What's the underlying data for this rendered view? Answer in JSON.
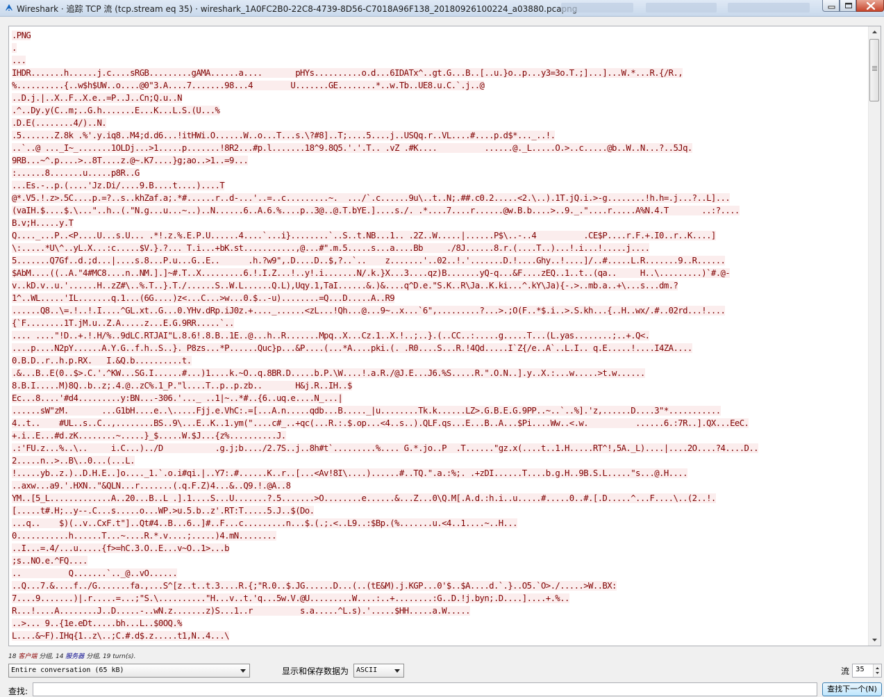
{
  "window": {
    "title": "Wireshark · 追踪 TCP 流 (tcp.stream eq 35) · wireshark_1A0FC2B0-22C8-4739-8D56-C7018A96F138_20180926100224_a03880.pcapng"
  },
  "stream": {
    "lines": [
      ".PNG",
      ".",
      "...",
      "IHDR.......h......j.c....sRGB.........gAMA......a....       pHYs..........o.d...6IDATx^..gt.G...B..[..u.}o..p...y3=3o.T.;]...]...W.*...R.{/R.,",
      "%..........{..w$h$UW..o....@0\"3.A....7.......98...4        U.......GE........*..w.Tb..UE8.u.C.`.j..@",
      "..D.j.|..X..F..X.e..=P..J..Cn;Q.u..N",
      ".^..Dy.y(C..m;..G.h.......E...K...L.S.(U...%",
      ".D.E(........4/)..N.",
      ".5.......Z.8k .%'.y.iq8..M4;d.d6...!itHWi.O......W..o...T...s.\\?#8]..T;....5....j..USQq.r..VL....#....p.d$*..._..!.",
      "..`..@ ..._I~_.......1OLDj...>1.....p.......!8R2...#p.l.......18^9.8Q5.'.'.T.. .vZ .#K....          ......@._L.....O.>..c.....@b..W..N...?..5Jq.",
      "9RB...~^.p....>..8T....z.@~.K7....}g;ao..>1..=9...",
      ":......8.......u.....p8R..G",
      "...Es.-..p.(....'Jz.Di/....9.B....t....)....T",
      "@*.V5.!.z>.5C....p.=?..s..khZaf.a;.*#......r..d-...'..=..c.........~.  .../`.c......9u\\..t..N;.##.c0.2.....<2.\\..).1T.jQ.i.>-g........!h.h=.j...?..L]...",
      "(vaIH.$....$.\\...\"..h..(.\"N.g...u...~..)..N......6..A.6.%....p..3@..@.T.bYE.]....s./. .*....7....r......@w.B.b....>..9._.\"....r.....A%N.4.T       ..:?....",
      "B.v;H.....y.T",
      "Q...._...P..<P....U...s.U... .*!.z.%.E.P.U......4....`...i}........`..S..t.NB...1.. .2Z..W.....|......P$\\..-..4          .CE$P....r.F.+.I0..r..K....]",
      "\\:.....*U\\^..yL.X...:c.....$V.}.?... T.i...+bK.st...........,@...#\".m.5.....s...a....Bb     ./8J......8.r.(....T..)...!.i...!.....j....",
      "5.......Q7Gf..d.;d...|....s.8...P.u...G..E..      .h.?w9\",.D....D..$,?..`..    z.......'..02..!.'.......D.!....Ghy..!....]/..#.....L.R.......9..R......",
      "$AbM....((..A.\"4#MC8....n..NM.].]~#.T..X.........6.!.I.Z...!..y!.i.......N/.k.}X...3....qz)B.......yQ-q...&F....zEQ..1..t..(qa..     H..\\.........)`#.@-",
      "v..kD.v..u.'......H..zZ#\\..%.T..}.T./......S..W.L......Q.L),Uqy.1,TaI......&.)&....q^D.e.\"S.K..R\\Ja..K.ki...^.kY\\Ja){-.>..mb.a..+\\...s...dm.?",
      "1^..WL.....'IL.......q.1...(6G....)z<...C...>w...0.$..-u)........=Q...D.....A..R9",
      "......Q8..\\=.!..!.I....^GL.xt..G...0.YHv.dRp.iJ0z.+...._......<zL...!Qh...@...9~..x...`6\",.........?...>.;O(F..*$.i..>.S.kh...{..H..wx/.#..02rd...!....",
      "{`F........1T.jM.u..Z.A.....z...E.G.9RR.....`..",
      ".... ....\"!D..+.!.H/%..9dLC.RTJAI\"L.8.6!.8.B..1E..@...h..R.......Mpq..X...Cz.1..X.!..;..}.(..CC..:.....g.....T...(L.yas........;..+.Q<.",
      "....p....N2pY......A.Y.G..f.h..S..}. P8zs...*P......Quc}p...&P....(...*A....pki.(. .R0....S...R.!4Qd.....I`Z{/e..A`..L.I.. q.E.....!....I4ZA....",
      "0.B.D..r..h.p.RX.   I.&Q.b..........t.",
      ".&...B..E(0..$>.C.'.^KW...SG.I......#...)1....k.~O..q.8BR.D.....b.P.\\W....!.a.R./@J.E...J6.%S.....R.\".O.N..].y..X.:...w.....>t.w......",
      "8.B.I.....M)8Q..b..z;.4.@..zC%.1_P.\"l....T..p..p.zb..       H&j.R..IH..$",
      "Ec...8....'#d4.........y:BN...-306.'..._ ..1|~..*#..{6..uq.e....N_...|",
      "......sW\"zM.       ...G1bH....e..\\.....Fjj.e.VhC:.=[...A.n.....qdb...B....._|u........Tk.k......LZ>.G.B.E.G.9PP..~..`..%].'z,......D....3\"*...........",
      "4..t..    #UL..s..C..,........BS..9\\...E..K..1.ym(\"....c#_..+qc(...R.:.$.op...<4..s..).QLF.qs...E...B..A...$Pi....Ww..<.w.          ......6.:7R..].QX...EeC.",
      "+.i..E...#d.zK........~.....}_$.....W.$J...{z%..........J.",
      ".:'FU.z...%..\\..     i.C...)../D           .g.j;b..../2.7S..j..8h#t`.........%.... G.*.jo..P  .T......\"gz.x(....t..1.H.....RT^!,5A._L)....|....2O....?4....D..",
      "2.....n..>..B\\..0...(...L.",
      "!.....yb..z.)..D.H.E..]o...._1.`.o.i#qi.|..Y7:.#......K..r..[...<Av!8I\\....)......#..TQ.\".a.:%;. .+zDI......T....b.g.H..9B.S.L.....\"s...@.H....",
      "..axw...a9.'.HXN..\"&QLN...r.......(.q.F.Z)4...&..Q9.!.@A..8",
      "YM..[5_L.............A..20...B..L .].1....S...U.......?.5.......>O........e......&...Z...0\\Q.M[.A.d.:h.i..u.....#.....0..#.[.D.....^...F....\\..(2..!.",
      "[.....t#.H;..y--.C...s.....o...WP.>u.5.b..z'.RT:T.....5.J..$(Do.",
      "...q..    $)(..v..CxF.t\"]..Qt#4..B...6..]#..F...c.........n...$.(.;.<..L9..:$Bp.(%.......u.<4..1....~..H...",
      "0...........h......T...~....R.*.v....;.....)4.mN........",
      "..I...=.4/...u.....{f>=hC.3.O..E...v~O..1>...b",
      ";s..NO.e.^FQ....",
      "..          Q.......`.._@..vO......",
      "..Q...7.&....f../G.......fa.,...S^[z..t..t.3....R.{;\"R.0..$.JG......D...(..(tE&M).j.KGP...0'$..$A....d.`.}..O5.`O>./.....>W..BX:",
      "7....9.......)|.r.....=...;\"S.\\..........\"H...v..t.'q...5w.V.@U.........W....:..+........:G..D.!j.byn;.D....]....+.%..",
      "R...!....A........J..D.....-..wN.z.......z)S...1..r          s.a.....^L.s).'.....$HH.....a.W.....",
      "..>... 9..{1e.eDt.....bh...L..$0OQ.%",
      "L....&~F).IHq{1..z\\..;C.#.d$.z.....t1,N..4...\\"
    ]
  },
  "stats": {
    "count_client": "18",
    "label_client": "客户端",
    "label_packets_1": "分组,",
    "count_server": "14",
    "label_server": "服务器",
    "label_packets_2": "分组,",
    "turns": "19 turn(s)."
  },
  "controls": {
    "conversation_select": "Entire conversation (65 kB)",
    "save_as_label": "显示和保存数据为",
    "format_select": "ASCII",
    "stream_label": "流",
    "stream_number": "35",
    "find_label": "查找:",
    "find_value": "",
    "find_next_button": "查找下一个(N)"
  }
}
